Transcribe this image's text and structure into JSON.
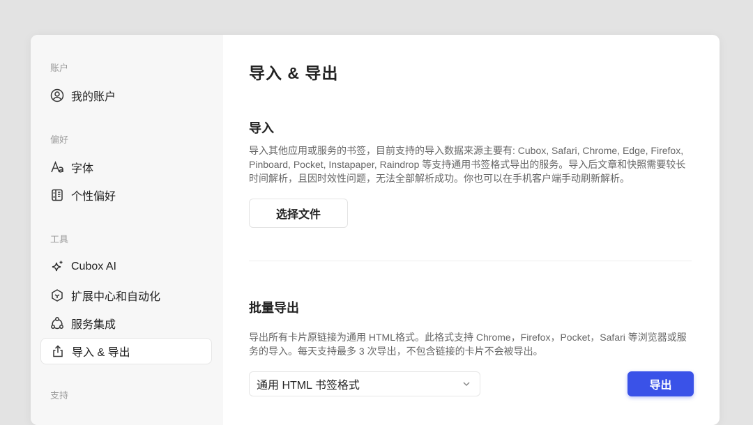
{
  "sidebar": {
    "sections": [
      {
        "title": "账户",
        "items": [
          {
            "icon": "user-circle-icon",
            "label": "我的账户"
          }
        ]
      },
      {
        "title": "偏好",
        "items": [
          {
            "icon": "font-icon",
            "label": "字体"
          },
          {
            "icon": "preferences-icon",
            "label": "个性偏好"
          }
        ]
      },
      {
        "title": "工具",
        "items": [
          {
            "icon": "sparkle-icon",
            "label": "Cubox AI"
          },
          {
            "icon": "extension-icon",
            "label": "扩展中心和自动化"
          },
          {
            "icon": "integration-icon",
            "label": "服务集成"
          },
          {
            "icon": "share-upload-icon",
            "label": "导入 & 导出",
            "active": true
          }
        ]
      },
      {
        "title": "支持",
        "items": []
      }
    ]
  },
  "main": {
    "title": "导入 & 导出",
    "import": {
      "heading": "导入",
      "description": "导入其他应用或服务的书签，目前支持的导入数据来源主要有: Cubox, Safari, Chrome, Edge, Firefox, Pinboard, Pocket, Instapaper, Raindrop 等支持通用书签格式导出的服务。导入后文章和快照需要较长时间解析，且因时效性问题，无法全部解析成功。你也可以在手机客户端手动刷新解析。",
      "button": "选择文件"
    },
    "export": {
      "heading": "批量导出",
      "description": "导出所有卡片原链接为通用 HTML格式。此格式支持 Chrome，Firefox，Pocket，Safari 等浏览器或服务的导入。每天支持最多 3 次导出，不包含链接的卡片不会被导出。",
      "format_selected": "通用 HTML 书签格式",
      "button": "导出"
    }
  },
  "colors": {
    "accent": "#3a52e8",
    "sidebar_bg": "#f7f7f7",
    "page_bg": "#e3e3e3"
  }
}
